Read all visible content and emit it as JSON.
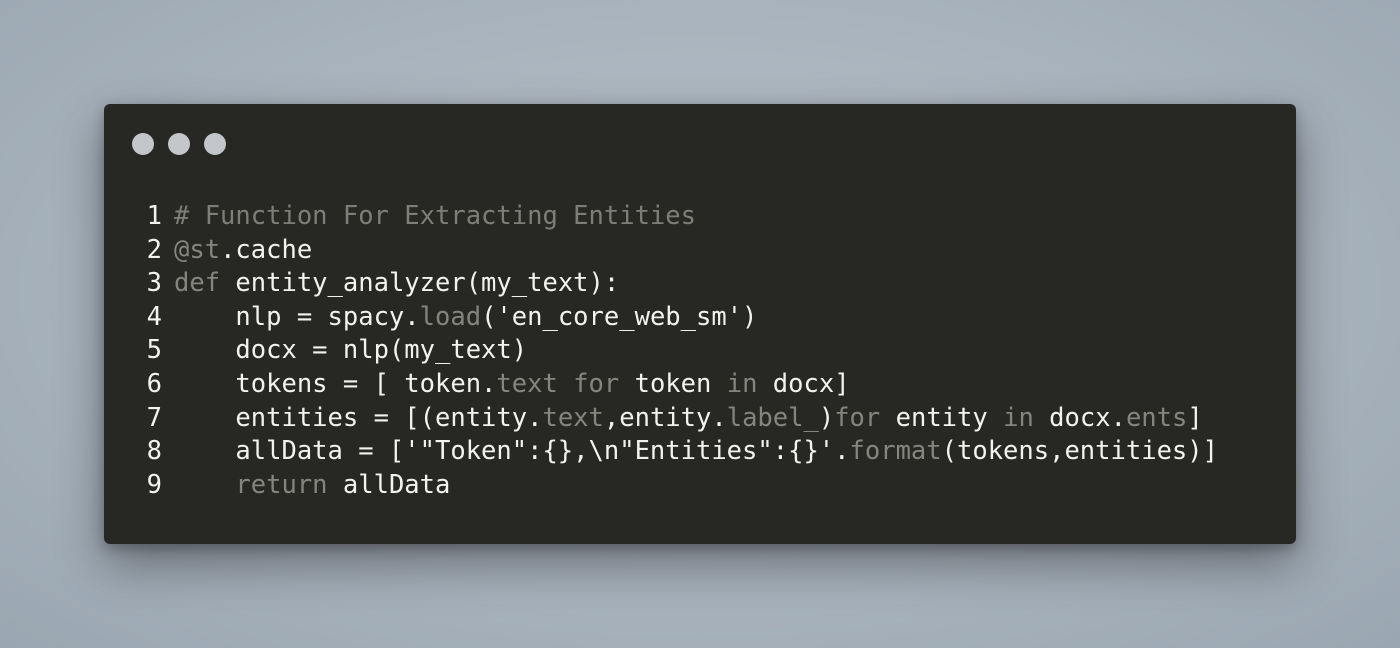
{
  "window": {
    "controls": [
      "close-dot",
      "minimize-dot",
      "zoom-dot"
    ]
  },
  "code": {
    "lines": [
      {
        "number": "1",
        "segments": [
          {
            "text": "# Function For Extracting Entities",
            "style": "comment"
          }
        ]
      },
      {
        "number": "2",
        "segments": [
          {
            "text": "@st",
            "style": "dim"
          },
          {
            "text": ".cache",
            "style": "plain"
          }
        ]
      },
      {
        "number": "3",
        "segments": [
          {
            "text": "def",
            "style": "dim"
          },
          {
            "text": " entity_analyzer(my_text):",
            "style": "plain"
          }
        ]
      },
      {
        "number": "4",
        "segments": [
          {
            "text": "    nlp = spacy.",
            "style": "plain"
          },
          {
            "text": "load",
            "style": "dim"
          },
          {
            "text": "('en_core_web_sm')",
            "style": "plain"
          }
        ]
      },
      {
        "number": "5",
        "segments": [
          {
            "text": "    docx = nlp(my_text)",
            "style": "plain"
          }
        ]
      },
      {
        "number": "6",
        "segments": [
          {
            "text": "    tokens = [ token.",
            "style": "plain"
          },
          {
            "text": "text",
            "style": "dim"
          },
          {
            "text": " ",
            "style": "plain"
          },
          {
            "text": "for",
            "style": "dim"
          },
          {
            "text": " token ",
            "style": "plain"
          },
          {
            "text": "in",
            "style": "dim"
          },
          {
            "text": " docx]",
            "style": "plain"
          }
        ]
      },
      {
        "number": "7",
        "segments": [
          {
            "text": "    entities = [(entity.",
            "style": "plain"
          },
          {
            "text": "text",
            "style": "dim"
          },
          {
            "text": ",entity.",
            "style": "plain"
          },
          {
            "text": "label_",
            "style": "dim"
          },
          {
            "text": ")",
            "style": "plain"
          },
          {
            "text": "for",
            "style": "dim"
          },
          {
            "text": " entity ",
            "style": "plain"
          },
          {
            "text": "in",
            "style": "dim"
          },
          {
            "text": " docx.",
            "style": "plain"
          },
          {
            "text": "ents",
            "style": "dim"
          },
          {
            "text": "]",
            "style": "plain"
          }
        ]
      },
      {
        "number": "8",
        "segments": [
          {
            "text": "    allData = ['\"Token\":{},\\n\"Entities\":{}'.",
            "style": "plain"
          },
          {
            "text": "format",
            "style": "dim"
          },
          {
            "text": "(tokens,entities)]",
            "style": "plain"
          }
        ]
      },
      {
        "number": "9",
        "segments": [
          {
            "text": "    ",
            "style": "plain"
          },
          {
            "text": "return",
            "style": "dim"
          },
          {
            "text": " allData",
            "style": "plain"
          }
        ]
      }
    ]
  },
  "colors": {
    "background": "#a9b4be",
    "window": "#272824",
    "text": "#f2f2ee",
    "dim_text": "#84857f",
    "comment": "#7d7e78",
    "dots": "#c3c6ca"
  }
}
